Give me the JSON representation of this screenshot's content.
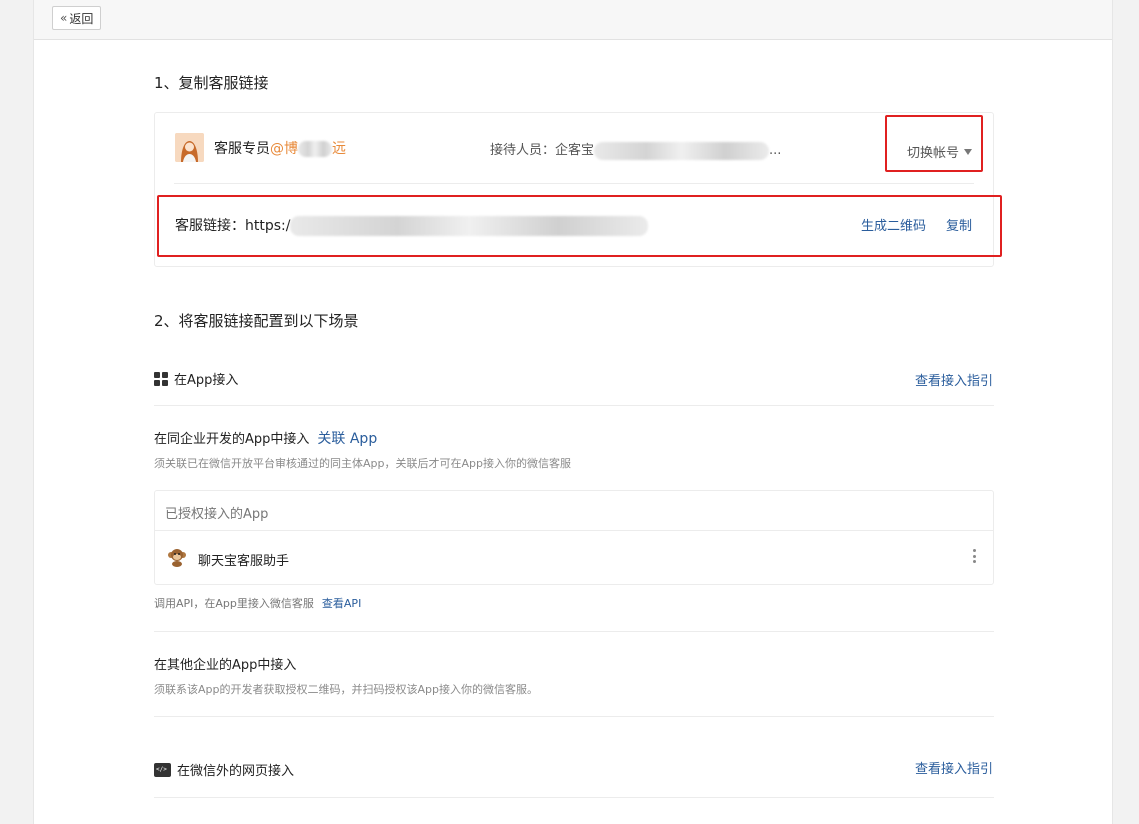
{
  "topbar": {
    "back_label": "返回",
    "back_icon": "double-chevron-left-icon"
  },
  "section1": {
    "title": "1、复制客服链接",
    "account": {
      "name": "客服专员",
      "org_suffix": "@博",
      "org_tail": "远",
      "receiver_label": "接待人员：企客宝",
      "receiver_ellipsis": "..."
    },
    "switch_label": "切换帐号",
    "link": {
      "label": "客服链接：https:/",
      "qr_label": "生成二维码",
      "copy_label": "复制"
    }
  },
  "section2": {
    "title": "2、将客服链接配置到以下场景",
    "app_access": {
      "title": "在App接入",
      "guide_label": "查看接入指引",
      "same_corp": {
        "title": "在同企业开发的App中接入",
        "link_label": "关联 App",
        "desc": "须关联已在微信开放平台审核通过的同主体App，关联后才可在App接入你的微信客服"
      },
      "authorized_header": "已授权接入的App",
      "apps": [
        {
          "name": "聊天宝客服助手"
        }
      ],
      "api_text": "调用API，在App里接入微信客服",
      "api_link": "查看API",
      "other_corp": {
        "title": "在其他企业的App中接入",
        "desc": "须联系该App的开发者获取授权二维码，并扫码授权该App接入你的微信客服。"
      }
    },
    "web_access": {
      "title": "在微信外的网页接入",
      "guide_label": "查看接入指引"
    }
  },
  "colors": {
    "link": "#2a5d9c",
    "highlight_border": "#e02020",
    "org_accent": "#e88a3a"
  }
}
